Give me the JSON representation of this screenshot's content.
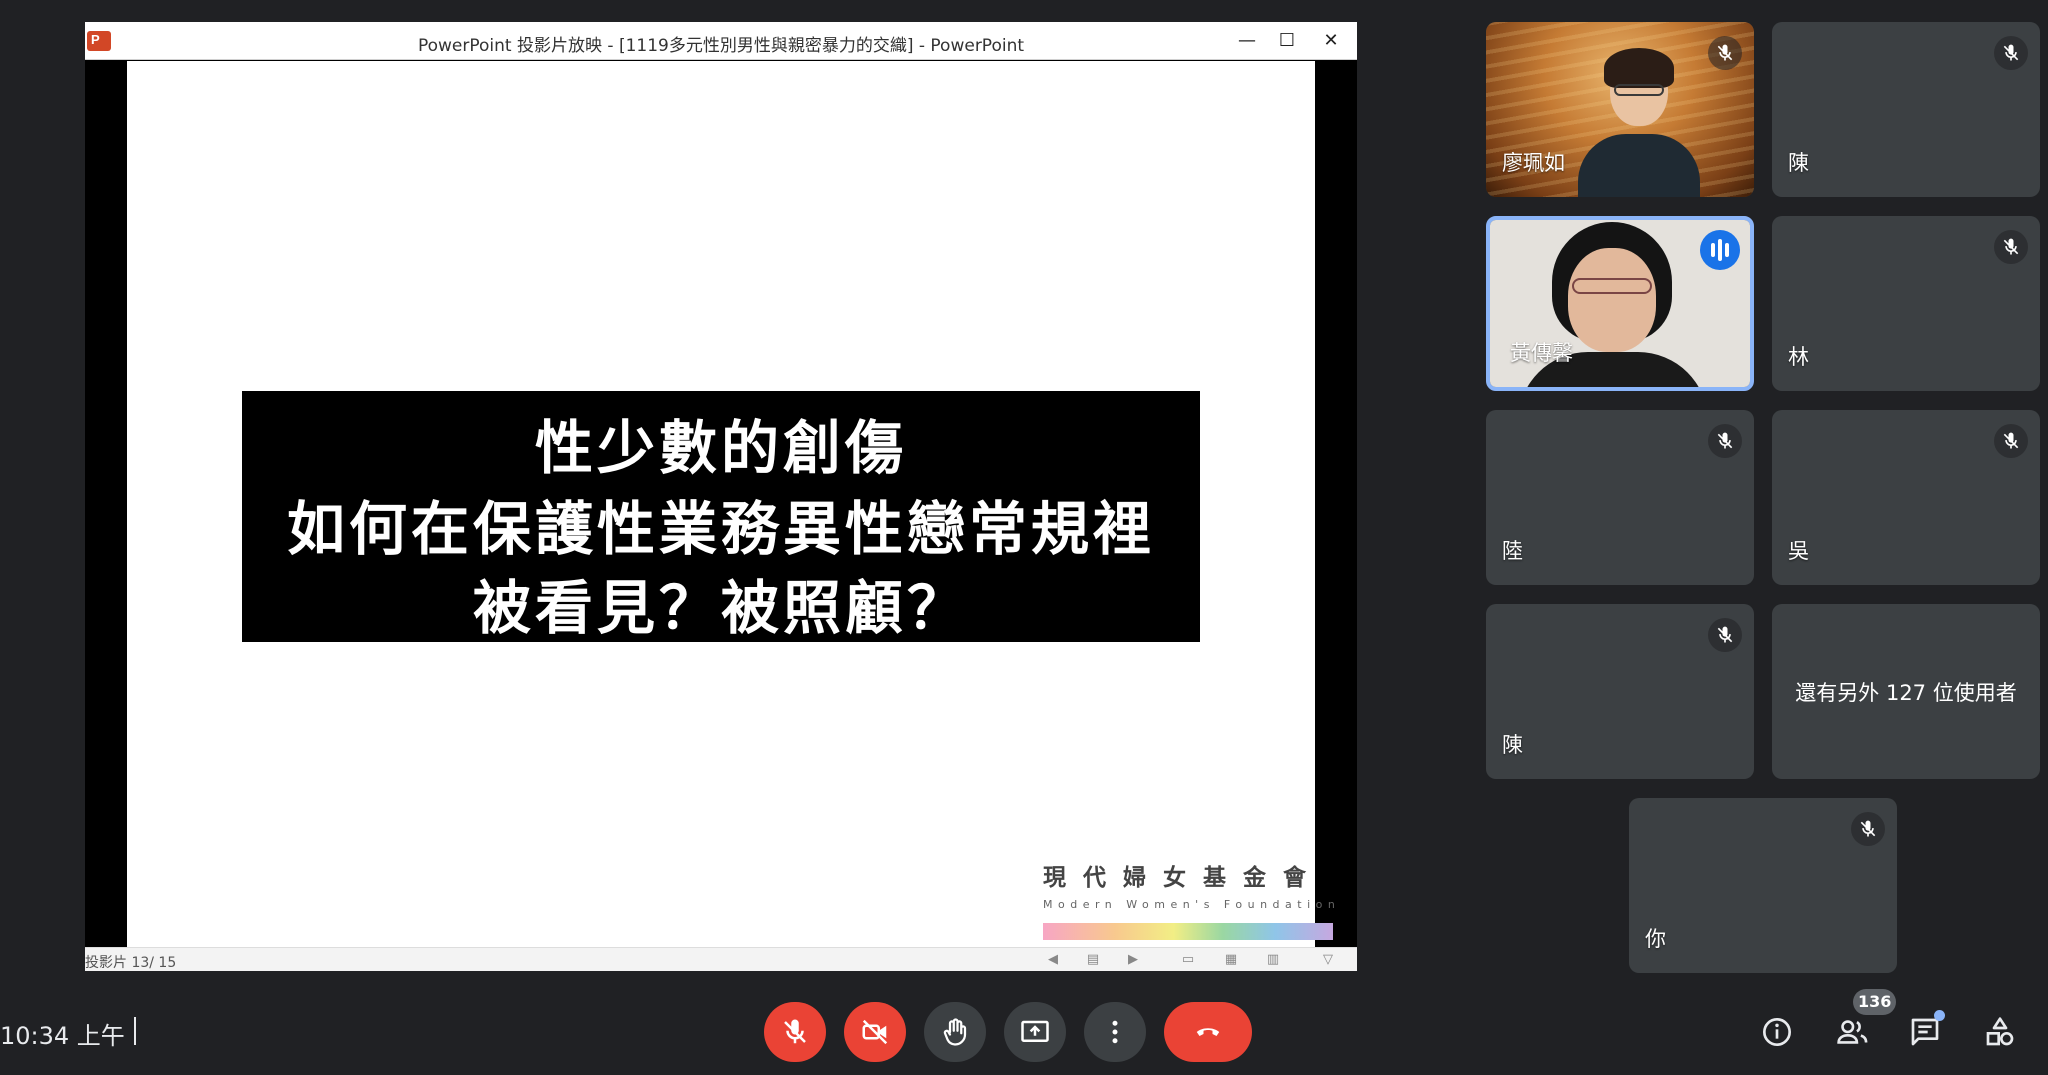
{
  "ppt": {
    "window_title": "PowerPoint 投影片放映 - [1119多元性別男性與親密暴力的交織] - PowerPoint",
    "logo_letter": "P",
    "min_glyph": "—",
    "max_glyph": "☐",
    "close_glyph": "✕",
    "slide_lines": [
      "性少數的創傷",
      "如何在保護性業務異性戀常規裡",
      "被看見？被照顧？"
    ],
    "foundation_cn": "現代婦女基金會",
    "foundation_en": "Modern Women's Foundation",
    "slide_counter": "投影片 13/ 15"
  },
  "participants": [
    {
      "name": "廖珮如",
      "muted": true,
      "video": true
    },
    {
      "name": "陳",
      "muted": true,
      "video": false
    },
    {
      "name": "黃傳馨",
      "muted": false,
      "speaking": true,
      "video": true
    },
    {
      "name": "林",
      "muted": true,
      "video": false
    },
    {
      "name": "陸",
      "muted": true,
      "video": false
    },
    {
      "name": "吳",
      "muted": true,
      "video": false
    },
    {
      "name": "陳",
      "muted": true,
      "video": false
    },
    {
      "name": "還有另外 127 位使用者",
      "muted": false,
      "video": false
    },
    {
      "name": "你",
      "muted": true,
      "video": false
    }
  ],
  "bottom_bar": {
    "clock": "10:34 上午",
    "controls": [
      "mic-off-icon",
      "camera-off-icon",
      "raise-hand-icon",
      "present-icon",
      "more-options-icon",
      "end-call-icon"
    ],
    "people_count": "136",
    "colors": {
      "red": "#ea4335",
      "accent": "#8ab4f8",
      "tile": "#3c4043",
      "background": "#202124"
    }
  }
}
